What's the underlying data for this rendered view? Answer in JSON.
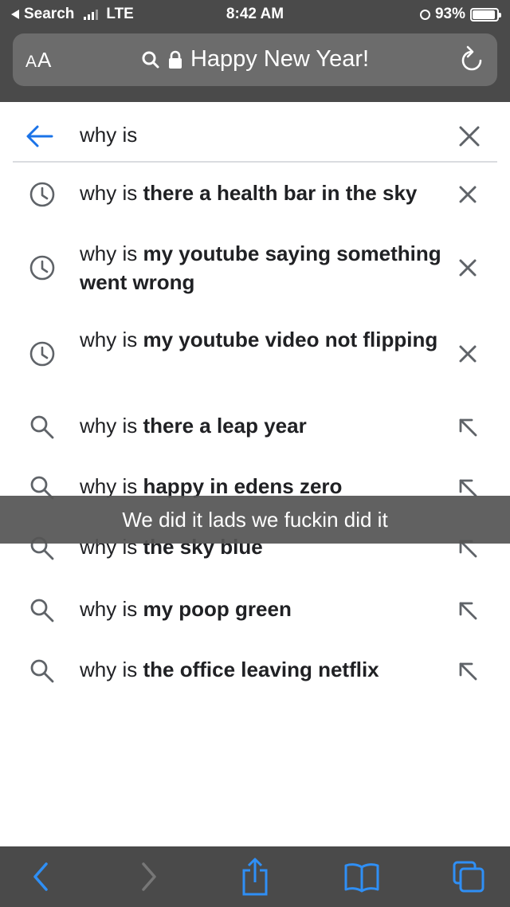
{
  "status_bar": {
    "back_app": "Search",
    "carrier": "LTE",
    "time": "8:42 AM",
    "battery_percent": "93%",
    "battery_level": 0.93
  },
  "url_bar": {
    "reader_button_large": "A",
    "reader_button_small": "A",
    "page_title": "Happy New Year!"
  },
  "search": {
    "query": "why is"
  },
  "suggestions": [
    {
      "type": "history",
      "prefix": "why is ",
      "completion": "there a health bar in the sky",
      "action": "remove"
    },
    {
      "type": "history",
      "prefix": "why is ",
      "completion": "my youtube saying something went wrong",
      "action": "remove"
    },
    {
      "type": "history",
      "prefix": "why is ",
      "completion": "my youtube video not flipping",
      "action": "remove"
    },
    {
      "type": "search",
      "prefix": "why is ",
      "completion": "there a leap year",
      "action": "fill"
    },
    {
      "type": "search",
      "prefix": "why is ",
      "completion": "happy in edens zero",
      "action": "fill"
    },
    {
      "type": "search",
      "prefix": "why is ",
      "completion": "the sky blue",
      "action": "fill"
    },
    {
      "type": "search",
      "prefix": "why is ",
      "completion": "my poop green",
      "action": "fill"
    },
    {
      "type": "search",
      "prefix": "why is ",
      "completion": "the office leaving netflix",
      "action": "fill"
    }
  ],
  "caption": {
    "text": "We did it lads we fuckin did it"
  },
  "toolbar": {
    "icons": [
      "chevron-left-icon",
      "chevron-right-icon",
      "share-icon",
      "bookmarks-icon",
      "tabs-icon"
    ]
  },
  "colors": {
    "chrome_bg": "#4a4a4a",
    "url_field_bg": "#6c6c6c",
    "accent_blue": "#1a73e8",
    "toolbar_blue": "#2f8ff5",
    "icon_gray": "#5f6368"
  }
}
